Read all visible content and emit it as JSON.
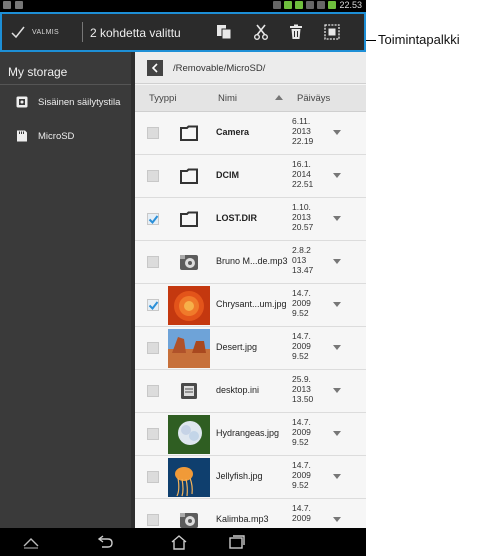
{
  "status_bar": {
    "time": "22.53"
  },
  "action_bar": {
    "done_label": "VALMIS",
    "selection_count": "2 kohdetta valittu",
    "tools": [
      {
        "name": "copy-icon"
      },
      {
        "name": "cut-icon"
      },
      {
        "name": "delete-icon"
      },
      {
        "name": "select-all-icon"
      }
    ]
  },
  "sidebar": {
    "title": "My storage",
    "items": [
      {
        "label": "Sisäinen säilytystila",
        "icon": "internal-storage-icon"
      },
      {
        "label": "MicroSD",
        "icon": "sd-card-icon"
      }
    ]
  },
  "path": {
    "text": "/Removable/MicroSD/"
  },
  "columns": {
    "type": "Tyyppi",
    "name": "Nimi",
    "date": "Päiväys"
  },
  "files": [
    {
      "name": "Camera",
      "date": "6.11.\n2013\n22.19",
      "kind": "folder",
      "checked": false
    },
    {
      "name": "DCIM",
      "date": "16.1.\n2014\n22.51",
      "kind": "folder",
      "checked": false
    },
    {
      "name": "LOST.DIR",
      "date": "1.10.\n2013\n20.57",
      "kind": "folder",
      "checked": true
    },
    {
      "name": "Bruno M...de.mp3",
      "date": "2.8.2\n013\n13.47",
      "kind": "audio",
      "checked": false
    },
    {
      "name": "Chrysant...um.jpg",
      "date": "14.7.\n2009\n9.52",
      "kind": "image-flower",
      "checked": true
    },
    {
      "name": "Desert.jpg",
      "date": "14.7.\n2009\n9.52",
      "kind": "image-desert",
      "checked": false
    },
    {
      "name": "desktop.ini",
      "date": "25.9.\n2013\n13.50",
      "kind": "text",
      "checked": false
    },
    {
      "name": "Hydrangeas.jpg",
      "date": "14.7.\n2009\n9.52",
      "kind": "image-hydrangea",
      "checked": false
    },
    {
      "name": "Jellyfish.jpg",
      "date": "14.7.\n2009\n9.52",
      "kind": "image-jellyfish",
      "checked": false
    },
    {
      "name": "Kalimba.mp3",
      "date": "14.7.\n2009",
      "kind": "audio",
      "checked": false
    }
  ],
  "callout": {
    "label": "Toimintapalkki"
  }
}
